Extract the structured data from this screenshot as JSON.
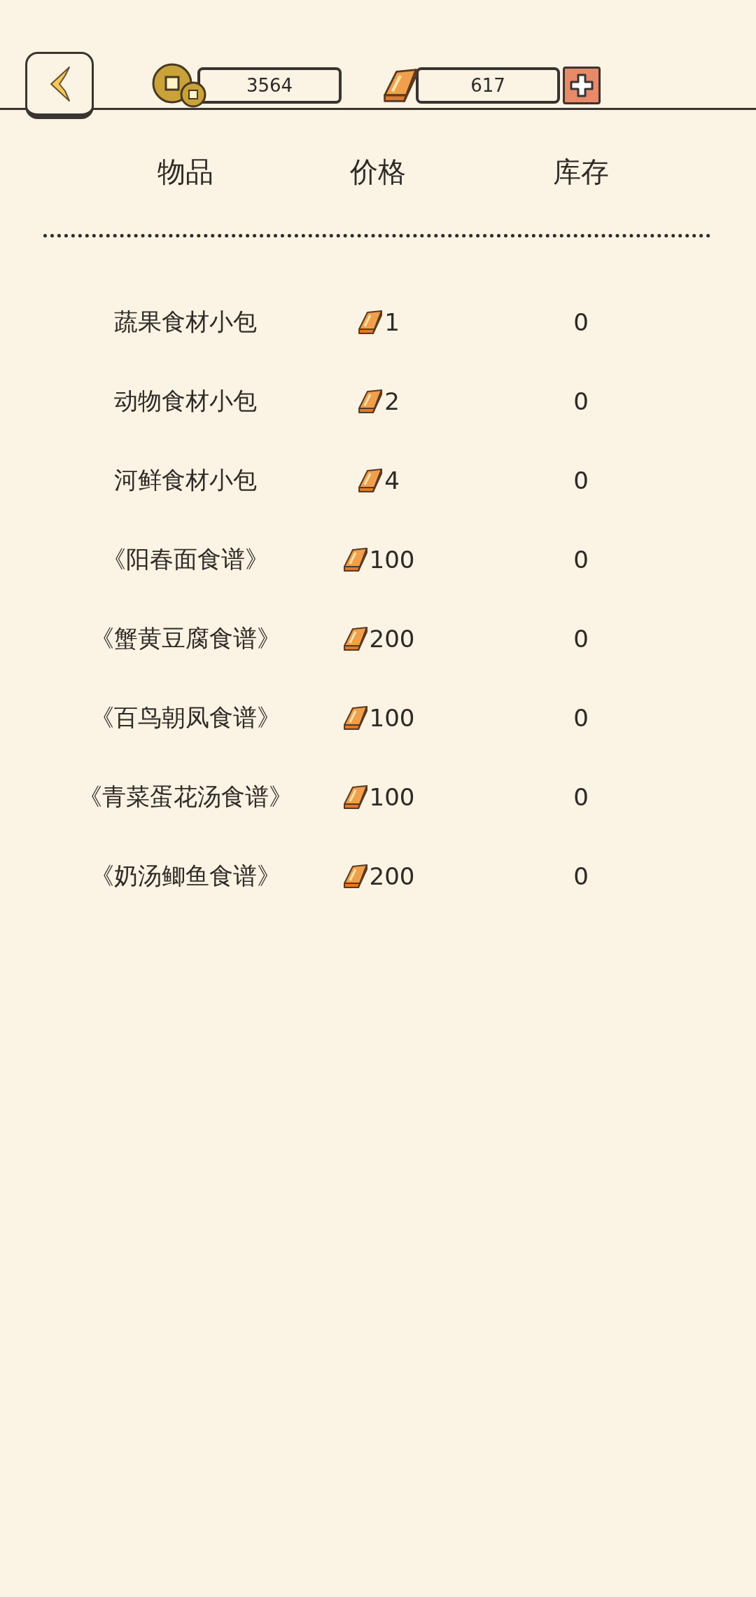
{
  "currency": {
    "coins": "3564",
    "gold": "617"
  },
  "columns": [
    "物品",
    "价格",
    "库存"
  ],
  "items": [
    {
      "name": "蔬果食材小包",
      "price": "1",
      "stock": "0"
    },
    {
      "name": "动物食材小包",
      "price": "2",
      "stock": "0"
    },
    {
      "name": "河鲜食材小包",
      "price": "4",
      "stock": "0"
    },
    {
      "name": "《阳春面食谱》",
      "price": "100",
      "stock": "0"
    },
    {
      "name": "《蟹黄豆腐食谱》",
      "price": "200",
      "stock": "0"
    },
    {
      "name": "《百鸟朝凤食谱》",
      "price": "100",
      "stock": "0"
    },
    {
      "name": "《青菜蛋花汤食谱》",
      "price": "100",
      "stock": "0"
    },
    {
      "name": "《奶汤鲫鱼食谱》",
      "price": "200",
      "stock": "0"
    }
  ]
}
